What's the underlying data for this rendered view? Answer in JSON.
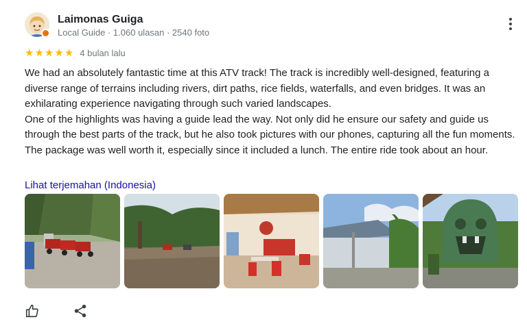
{
  "reviewer": {
    "name": "Laimonas Guiga",
    "meta": "Local Guide · 1.060 ulasan · 2540 foto",
    "avatar_icon": "avatar-cartoon-icon",
    "badge_color": "#e8710a"
  },
  "rating": {
    "stars": 5,
    "when": "4 bulan lalu",
    "star_color": "#fbbc04"
  },
  "review": {
    "paragraphs": [
      "We had an absolutely fantastic time at this ATV track! The track is incredibly well-designed, featuring a diverse range of terrains including rivers, dirt paths, rice fields, waterfalls, and even bridges. It was an exhilarating experience navigating through such varied landscapes.",
      "One of the highlights was having a guide lead the way. Not only did he ensure our safety and guide us through the best parts of the track, but he also took pictures with our phones, capturing all the fun moments.",
      "The package was well worth it, especially since it included a lunch. The entire ride took about an hour."
    ]
  },
  "translate_link": "Lihat terjemahan (Indonesia)",
  "link_color": "#1a0dab",
  "photos": [
    {
      "subject": "atv-parking"
    },
    {
      "subject": "muddy-river-track"
    },
    {
      "subject": "restaurant-interior"
    },
    {
      "subject": "resort-building"
    },
    {
      "subject": "stone-statue"
    }
  ],
  "actions": [
    {
      "icon": "thumbs-up-icon"
    },
    {
      "icon": "share-icon"
    }
  ]
}
